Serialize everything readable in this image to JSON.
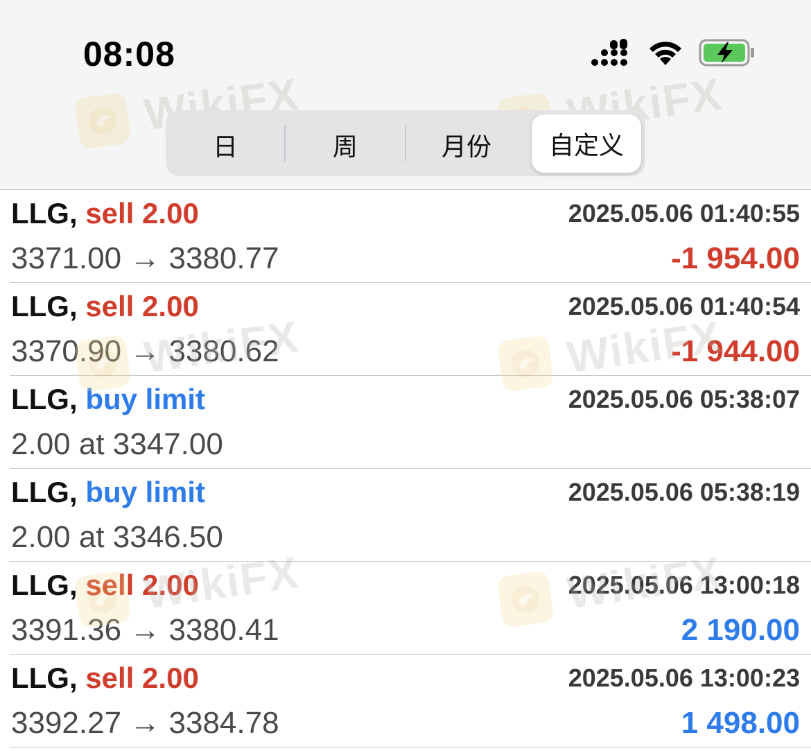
{
  "status_bar": {
    "time": "08:08",
    "icons": [
      "cellular-signal-icon",
      "wifi-icon",
      "battery-charging-icon"
    ]
  },
  "segmented_control": {
    "items": [
      {
        "label": "日",
        "selected": false
      },
      {
        "label": "周",
        "selected": false
      },
      {
        "label": "月份",
        "selected": false
      },
      {
        "label": "自定义",
        "selected": true
      }
    ]
  },
  "watermark": {
    "text": "WikiFX"
  },
  "colors": {
    "sell": "#d03d2c",
    "buy": "#2e7bea",
    "loss": "#d03d2c",
    "profit": "#2e7bea"
  },
  "orders": [
    {
      "symbol": "LLG,",
      "action": "sell 2.00",
      "type": "sell",
      "time": "2025.05.06 01:40:55",
      "detail": "3371.00 → 3380.77",
      "profit": "-1 954.00",
      "profit_sign": "neg"
    },
    {
      "symbol": "LLG,",
      "action": "sell 2.00",
      "type": "sell",
      "time": "2025.05.06 01:40:54",
      "detail": "3370.90 → 3380.62",
      "profit": "-1 944.00",
      "profit_sign": "neg"
    },
    {
      "symbol": "LLG,",
      "action": "buy limit",
      "type": "buy",
      "time": "2025.05.06 05:38:07",
      "detail": "2.00 at 3347.00",
      "profit": "",
      "profit_sign": ""
    },
    {
      "symbol": "LLG,",
      "action": "buy limit",
      "type": "buy",
      "time": "2025.05.06 05:38:19",
      "detail": "2.00 at 3346.50",
      "profit": "",
      "profit_sign": ""
    },
    {
      "symbol": "LLG,",
      "action": "sell 2.00",
      "type": "sell",
      "time": "2025.05.06 13:00:18",
      "detail": "3391.36 → 3380.41",
      "profit": "2 190.00",
      "profit_sign": "pos"
    },
    {
      "symbol": "LLG,",
      "action": "sell 2.00",
      "type": "sell",
      "time": "2025.05.06 13:00:23",
      "detail": "3392.27 → 3384.78",
      "profit": "1 498.00",
      "profit_sign": "pos"
    }
  ]
}
